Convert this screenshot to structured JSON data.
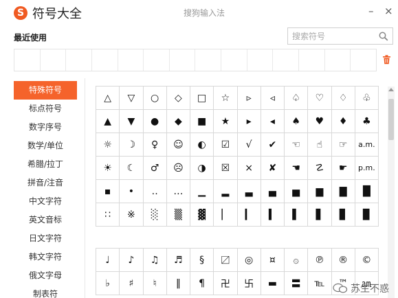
{
  "app": {
    "logo": "S",
    "title": "符号大全",
    "center_title": "搜狗输入法",
    "minimize": "–",
    "close": "×"
  },
  "recent": {
    "label": "最近使用",
    "cells": 14
  },
  "search": {
    "placeholder": "搜索符号"
  },
  "icons": {
    "search": "magnifier-icon",
    "trash": "trash-icon",
    "accent": "#f5632b"
  },
  "categories": [
    "特殊符号",
    "标点符号",
    "数字序号",
    "数学/单位",
    "希腊/拉丁",
    "拼音/注音",
    "中文字符",
    "英文音标",
    "日文字符",
    "韩文字符",
    "俄文字母",
    "制表符"
  ],
  "active_category": 0,
  "grid1": [
    "△",
    "▽",
    "○",
    "◇",
    "□",
    "☆",
    "▹",
    "◃",
    "♤",
    "♡",
    "♢",
    "♧",
    "▲",
    "▼",
    "●",
    "◆",
    "■",
    "★",
    "▸",
    "◂",
    "♠",
    "♥",
    "♦",
    "♣",
    "☼",
    "☽",
    "♀",
    "☺",
    "◐",
    "☑",
    "√",
    "✔",
    "☜",
    "☝",
    "☞",
    "a.m.",
    "☀",
    "☾",
    "♂",
    "☹",
    "◑",
    "☒",
    "×",
    "✘",
    "☚",
    "☡",
    "☛",
    "p.m.",
    "▪",
    "•",
    "‥",
    "…",
    "▁",
    "▂",
    "▃",
    "▄",
    "▅",
    "▆",
    "▇",
    "█",
    "∷",
    "※",
    "░",
    "▒",
    "▓",
    "▏",
    "▎",
    "▍",
    "▌",
    "▋",
    "▊",
    "▉"
  ],
  "grid2": [
    "♩",
    "♪",
    "♫",
    "♬",
    "§",
    "〼",
    "◎",
    "¤",
    "۞",
    "℗",
    "®",
    "©",
    "♭",
    "♯",
    "♮",
    "‖",
    "¶",
    "卍",
    "卐",
    "▬",
    "〓",
    "℡",
    "™",
    "㏂"
  ],
  "watermark": {
    "text": "苏生不惑"
  }
}
